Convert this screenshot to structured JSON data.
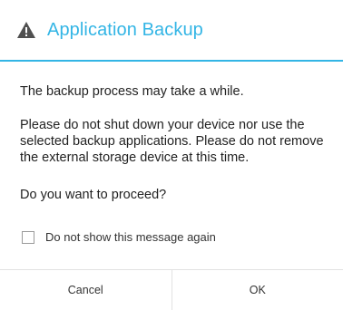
{
  "dialog": {
    "title": "Application Backup",
    "title_icon": "warning-icon",
    "accent_color": "#33b5e5",
    "messages": [
      "The backup process may take a while.",
      "Please do not shut down your device nor use the selected backup applications. Please do not remove the external storage device at this time.",
      "Do you want to proceed?"
    ],
    "checkbox": {
      "label": "Do not show this message again",
      "checked": false
    },
    "buttons": {
      "cancel_label": "Cancel",
      "ok_label": "OK"
    }
  }
}
